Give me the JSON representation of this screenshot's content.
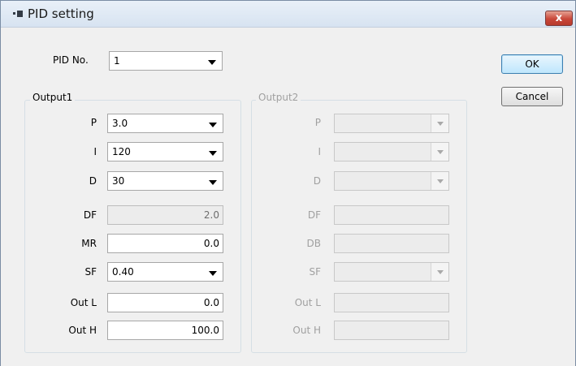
{
  "window": {
    "title": "PID setting",
    "close_label": "x"
  },
  "pid_no": {
    "label": "PID No.",
    "value": "1"
  },
  "buttons": {
    "ok": "OK",
    "cancel": "Cancel"
  },
  "output1": {
    "title": "Output1",
    "p": {
      "label": "P",
      "value": "3.0"
    },
    "i": {
      "label": "I",
      "value": "120"
    },
    "d": {
      "label": "D",
      "value": "30"
    },
    "df": {
      "label": "DF",
      "value": "2.0"
    },
    "mr": {
      "label": "MR",
      "value": "0.0"
    },
    "sf": {
      "label": "SF",
      "value": "0.40"
    },
    "out_l": {
      "label": "Out L",
      "value": "0.0"
    },
    "out_h": {
      "label": "Out H",
      "value": "100.0"
    }
  },
  "output2": {
    "title": "Output2",
    "p": {
      "label": "P",
      "value": ""
    },
    "i": {
      "label": "I",
      "value": ""
    },
    "d": {
      "label": "D",
      "value": ""
    },
    "df": {
      "label": "DF",
      "value": ""
    },
    "db": {
      "label": "DB",
      "value": ""
    },
    "sf": {
      "label": "SF",
      "value": ""
    },
    "out_l": {
      "label": "Out L",
      "value": ""
    },
    "out_h": {
      "label": "Out H",
      "value": ""
    }
  }
}
